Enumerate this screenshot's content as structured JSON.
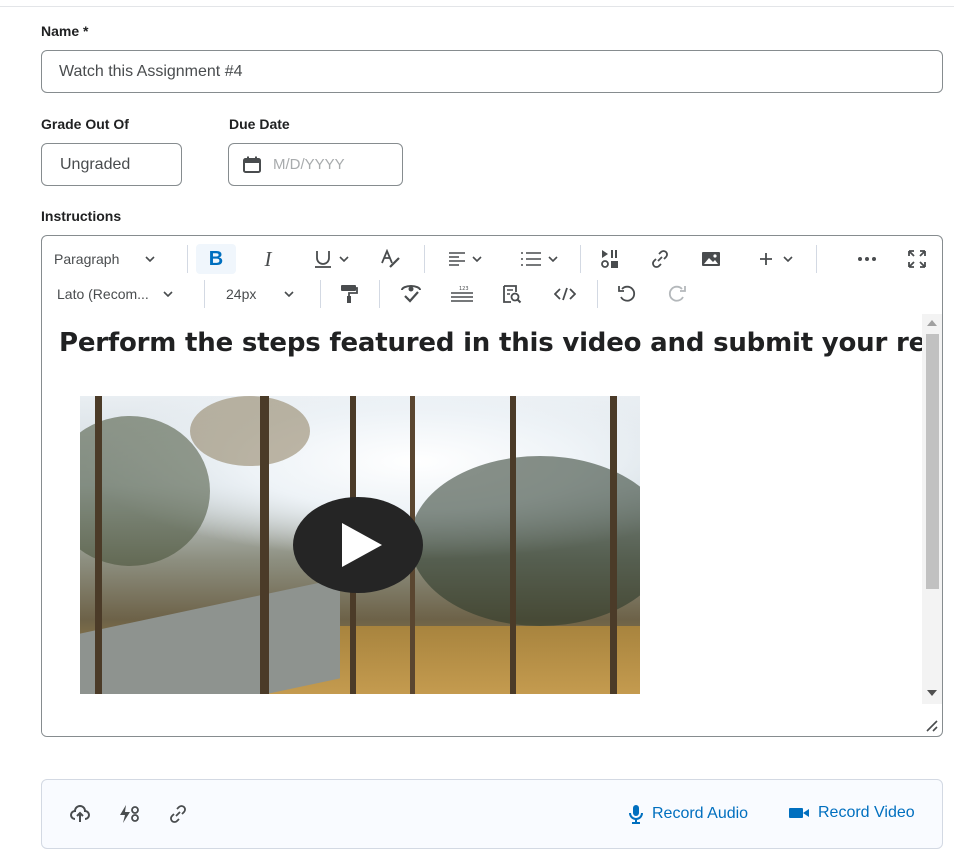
{
  "form": {
    "name_label": "Name *",
    "name_value": "Watch this Assignment #4",
    "grade_label": "Grade Out Of",
    "grade_value": "Ungraded",
    "due_label": "Due Date",
    "due_placeholder": "M/D/YYYY",
    "instructions_label": "Instructions"
  },
  "toolbar": {
    "paragraph": "Paragraph",
    "bold": "B",
    "italic": "I",
    "font": "Lato (Recom...",
    "size": "24px"
  },
  "content": {
    "heading": "Perform the steps featured in this video and submit your results."
  },
  "attachments": {
    "record_audio": "Record Audio",
    "record_video": "Record Video"
  },
  "colors": {
    "accent": "#006fbf",
    "border": "#868c8f"
  },
  "icons": [
    "calendar-icon",
    "chevron-down-icon",
    "underline-icon",
    "text-style-icon",
    "align-icon",
    "list-icon",
    "insert-stuff-icon",
    "link-icon",
    "image-icon",
    "plus-icon",
    "more-icon",
    "fullscreen-icon",
    "format-painter-icon",
    "spellcheck-icon",
    "word-count-icon",
    "preview-icon",
    "source-code-icon",
    "undo-icon",
    "redo-icon",
    "play-icon",
    "upload-icon",
    "quicklink-icon",
    "microphone-icon",
    "video-camera-icon"
  ]
}
